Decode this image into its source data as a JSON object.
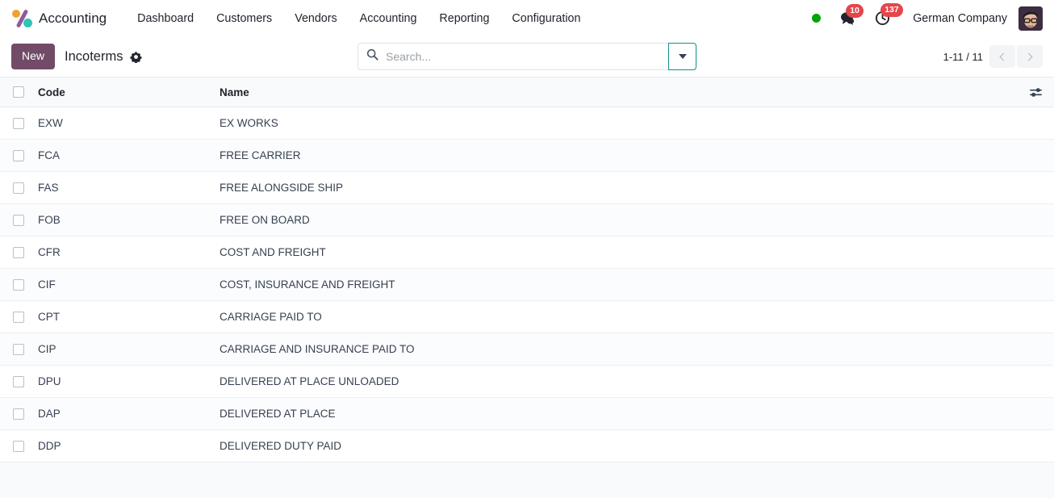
{
  "navbar": {
    "brand": "Accounting",
    "logo_icon": "odoo-percent-logo",
    "menu_items": [
      {
        "label": "Dashboard"
      },
      {
        "label": "Customers"
      },
      {
        "label": "Vendors"
      },
      {
        "label": "Accounting"
      },
      {
        "label": "Reporting"
      },
      {
        "label": "Configuration"
      }
    ],
    "status_dot_color": "#00a500",
    "messages": {
      "icon": "chat-bubble-icon",
      "count": "10"
    },
    "activities": {
      "icon": "clock-icon",
      "count": "137"
    },
    "company": "German Company",
    "avatar_alt": "user-avatar"
  },
  "control_panel": {
    "new_label": "New",
    "title": "Incoterms",
    "settings_icon": "gear-icon",
    "search": {
      "icon": "search-icon",
      "placeholder": "Search...",
      "value": "",
      "toggle_icon": "caret-down-icon"
    },
    "pager": {
      "range": "1-11 / 11",
      "prev_icon": "chevron-left-icon",
      "next_icon": "chevron-right-icon"
    }
  },
  "list": {
    "select_all_icon": "checkbox-unchecked",
    "optional_columns_icon": "sliders-icon",
    "columns": [
      "Code",
      "Name"
    ],
    "rows": [
      {
        "code": "EXW",
        "name": "EX WORKS"
      },
      {
        "code": "FCA",
        "name": "FREE CARRIER"
      },
      {
        "code": "FAS",
        "name": "FREE ALONGSIDE SHIP"
      },
      {
        "code": "FOB",
        "name": "FREE ON BOARD"
      },
      {
        "code": "CFR",
        "name": "COST AND FREIGHT"
      },
      {
        "code": "CIF",
        "name": "COST, INSURANCE AND FREIGHT"
      },
      {
        "code": "CPT",
        "name": "CARRIAGE PAID TO"
      },
      {
        "code": "CIP",
        "name": "CARRIAGE AND INSURANCE PAID TO"
      },
      {
        "code": "DPU",
        "name": "DELIVERED AT PLACE UNLOADED"
      },
      {
        "code": "DAP",
        "name": "DELIVERED AT PLACE"
      },
      {
        "code": "DDP",
        "name": "DELIVERED DUTY PAID"
      }
    ]
  },
  "colors": {
    "primary": "#714b67",
    "accent_teal": "#0d9488",
    "badge_red": "#e4464c",
    "status_green": "#00a500"
  }
}
